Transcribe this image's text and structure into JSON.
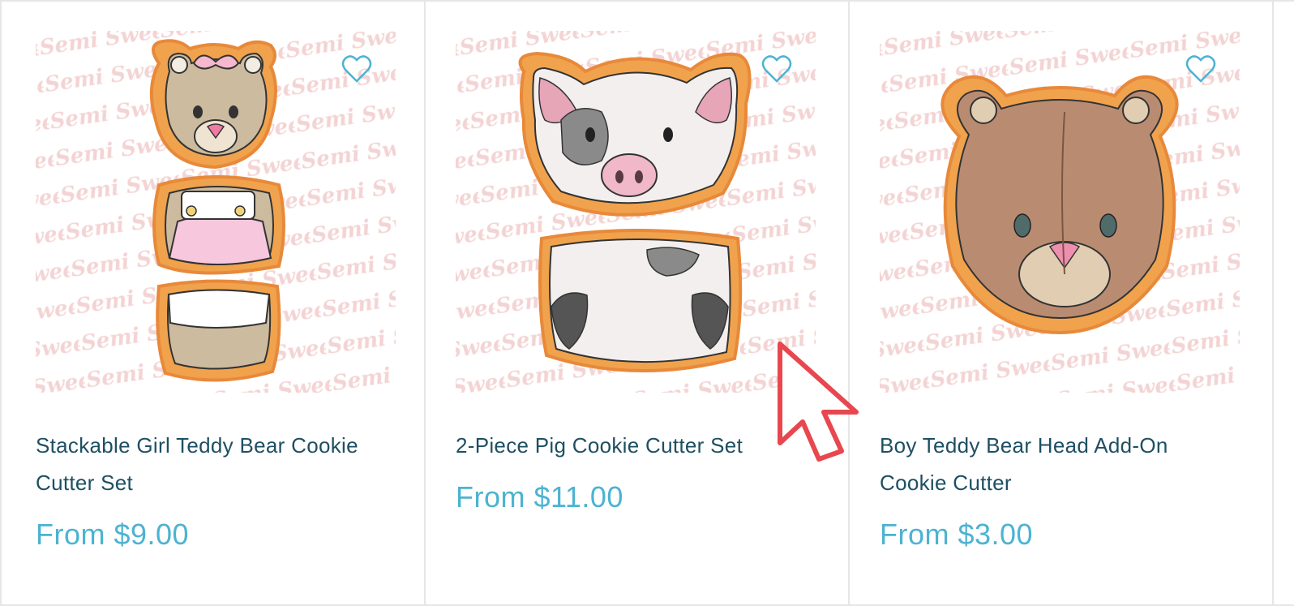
{
  "products": [
    {
      "title": "Stackable Girl Teddy Bear Cookie Cutter Set",
      "price": "From $9.00",
      "wishlist_icon": "heart-outline-icon",
      "image": "girl-teddy-bear-stack"
    },
    {
      "title": "2-Piece Pig Cookie Cutter Set",
      "price": "From $11.00",
      "wishlist_icon": "heart-outline-icon",
      "image": "pig-two-piece"
    },
    {
      "title": "Boy Teddy Bear Head Add-On Cookie Cutter",
      "price": "From $3.00",
      "wishlist_icon": "heart-outline-icon",
      "image": "boy-teddy-bear-head"
    }
  ],
  "watermark": "Semi Sweet",
  "colors": {
    "title": "#1e4f63",
    "price": "#4cb3d2",
    "heart": "#4cb3d2",
    "cutter_outline": "#e8893a",
    "watermark": "#f5d6d6",
    "cursor": "#e8474f"
  },
  "cursor_icon": "pointer-arrow-icon"
}
